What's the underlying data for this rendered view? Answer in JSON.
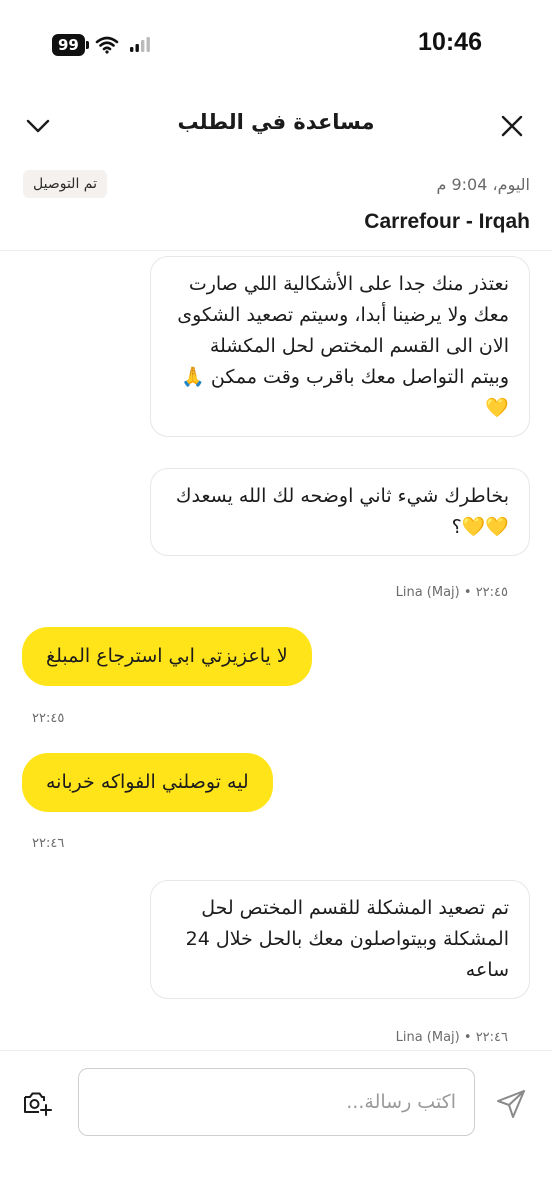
{
  "status_bar": {
    "battery": "99",
    "time": "10:46"
  },
  "header": {
    "title": "مساعدة في الطلب"
  },
  "order": {
    "status_badge": "تم التوصيل",
    "date": "اليوم، 9:04 م",
    "store": "Carrefour - Irqah"
  },
  "messages": [
    {
      "sender": "agent",
      "text": "نعتذر منك جدا على الأشكالية اللي صارت معك ولا يرضينا أبدا، وسيتم تصعيد الشكوى الان الى القسم المختص لحل المكشلة وبيتم التواصل معك باقرب وقت ممكن 🙏💛"
    },
    {
      "sender": "agent",
      "text": "بخاطرك شيء ثاني اوضحه لك الله يسعدك 💛💛؟",
      "meta": "Lina (Maj) • ٢٢:٤٥"
    },
    {
      "sender": "user",
      "text": "لا ياعزيزتي ابي استرجاع المبلغ",
      "meta": "٢٢:٤٥"
    },
    {
      "sender": "user",
      "text": "ليه توصلني الفواكه خربانه",
      "meta": "٢٢:٤٦"
    },
    {
      "sender": "agent",
      "text": "تم تصعيد المشكلة للقسم المختص لحل المشكلة وبيتواصلون معك بالحل خلال 24 ساعه",
      "meta": "Lina (Maj) • ٢٢:٤٦"
    }
  ],
  "composer": {
    "placeholder": "اكتب رسالة..."
  },
  "colors": {
    "user_bubble": "#ffe41a",
    "badge_bg": "#f4f1ee"
  },
  "icons": [
    "close-icon",
    "chevron-down-icon",
    "camera-add-icon",
    "send-icon",
    "wifi-icon",
    "signal-icon"
  ]
}
